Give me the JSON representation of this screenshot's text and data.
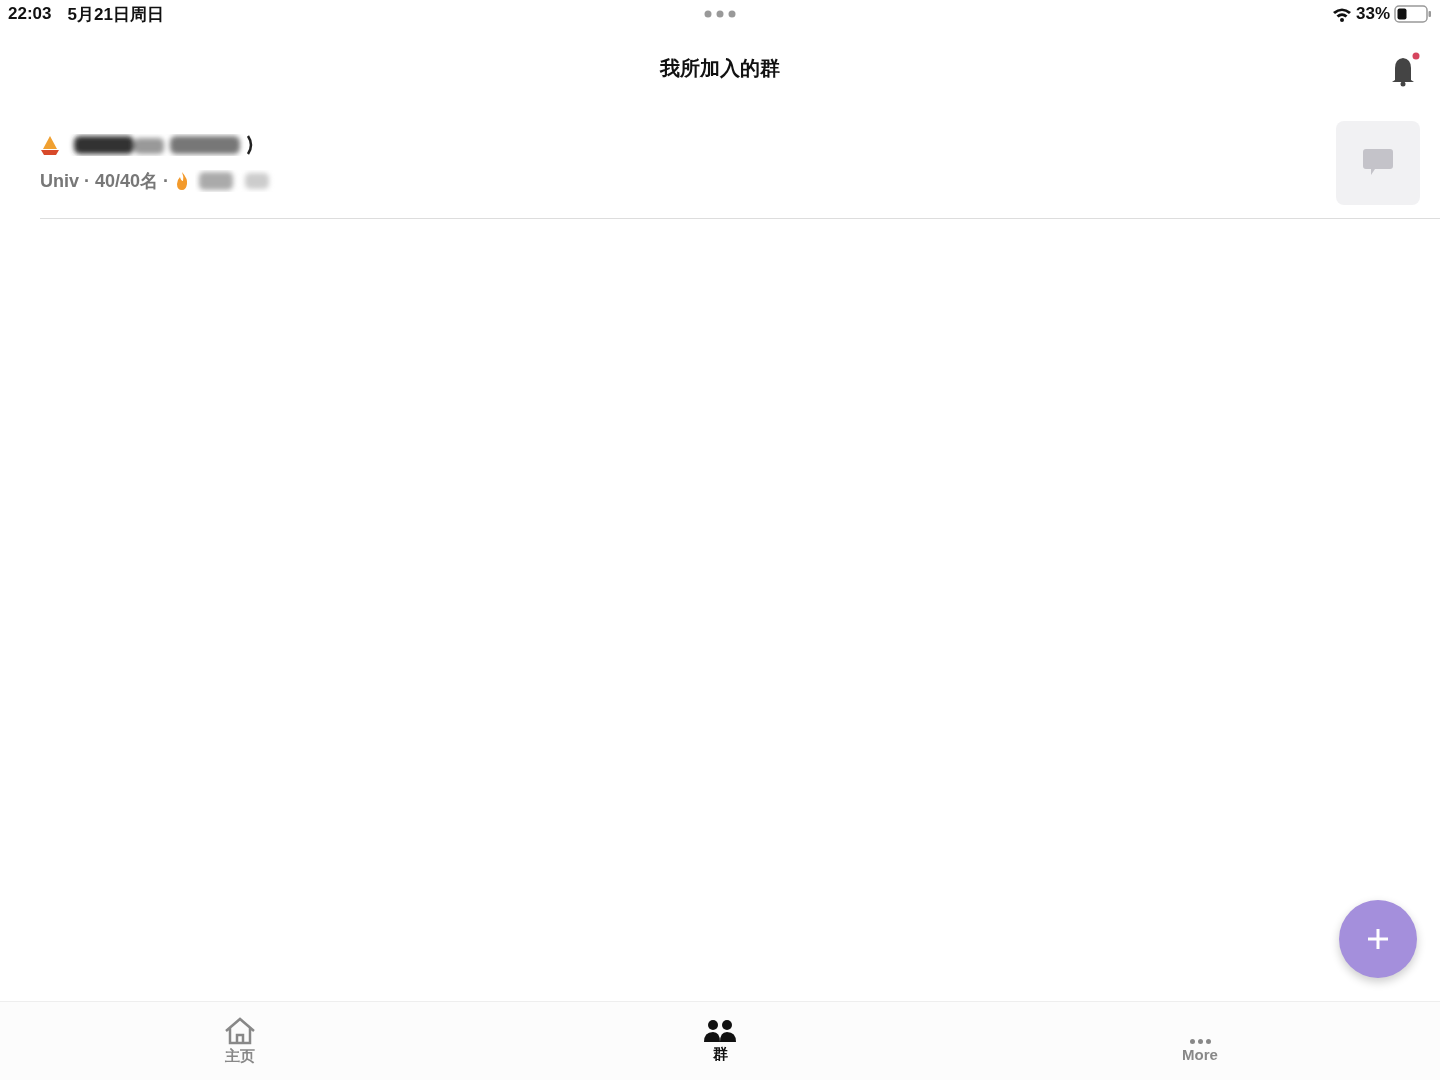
{
  "status_bar": {
    "time": "22:03",
    "date": "5月21日周日",
    "battery": "33%"
  },
  "header": {
    "title": "我所加入的群",
    "notification_unread": true
  },
  "groups": [
    {
      "meta": "Univ · 40/40名 ·"
    }
  ],
  "tabs": [
    {
      "label": "主页",
      "kind": "home",
      "selected": false
    },
    {
      "label": "群",
      "kind": "people",
      "selected": true
    },
    {
      "label": "More",
      "kind": "dots",
      "selected": false
    }
  ]
}
